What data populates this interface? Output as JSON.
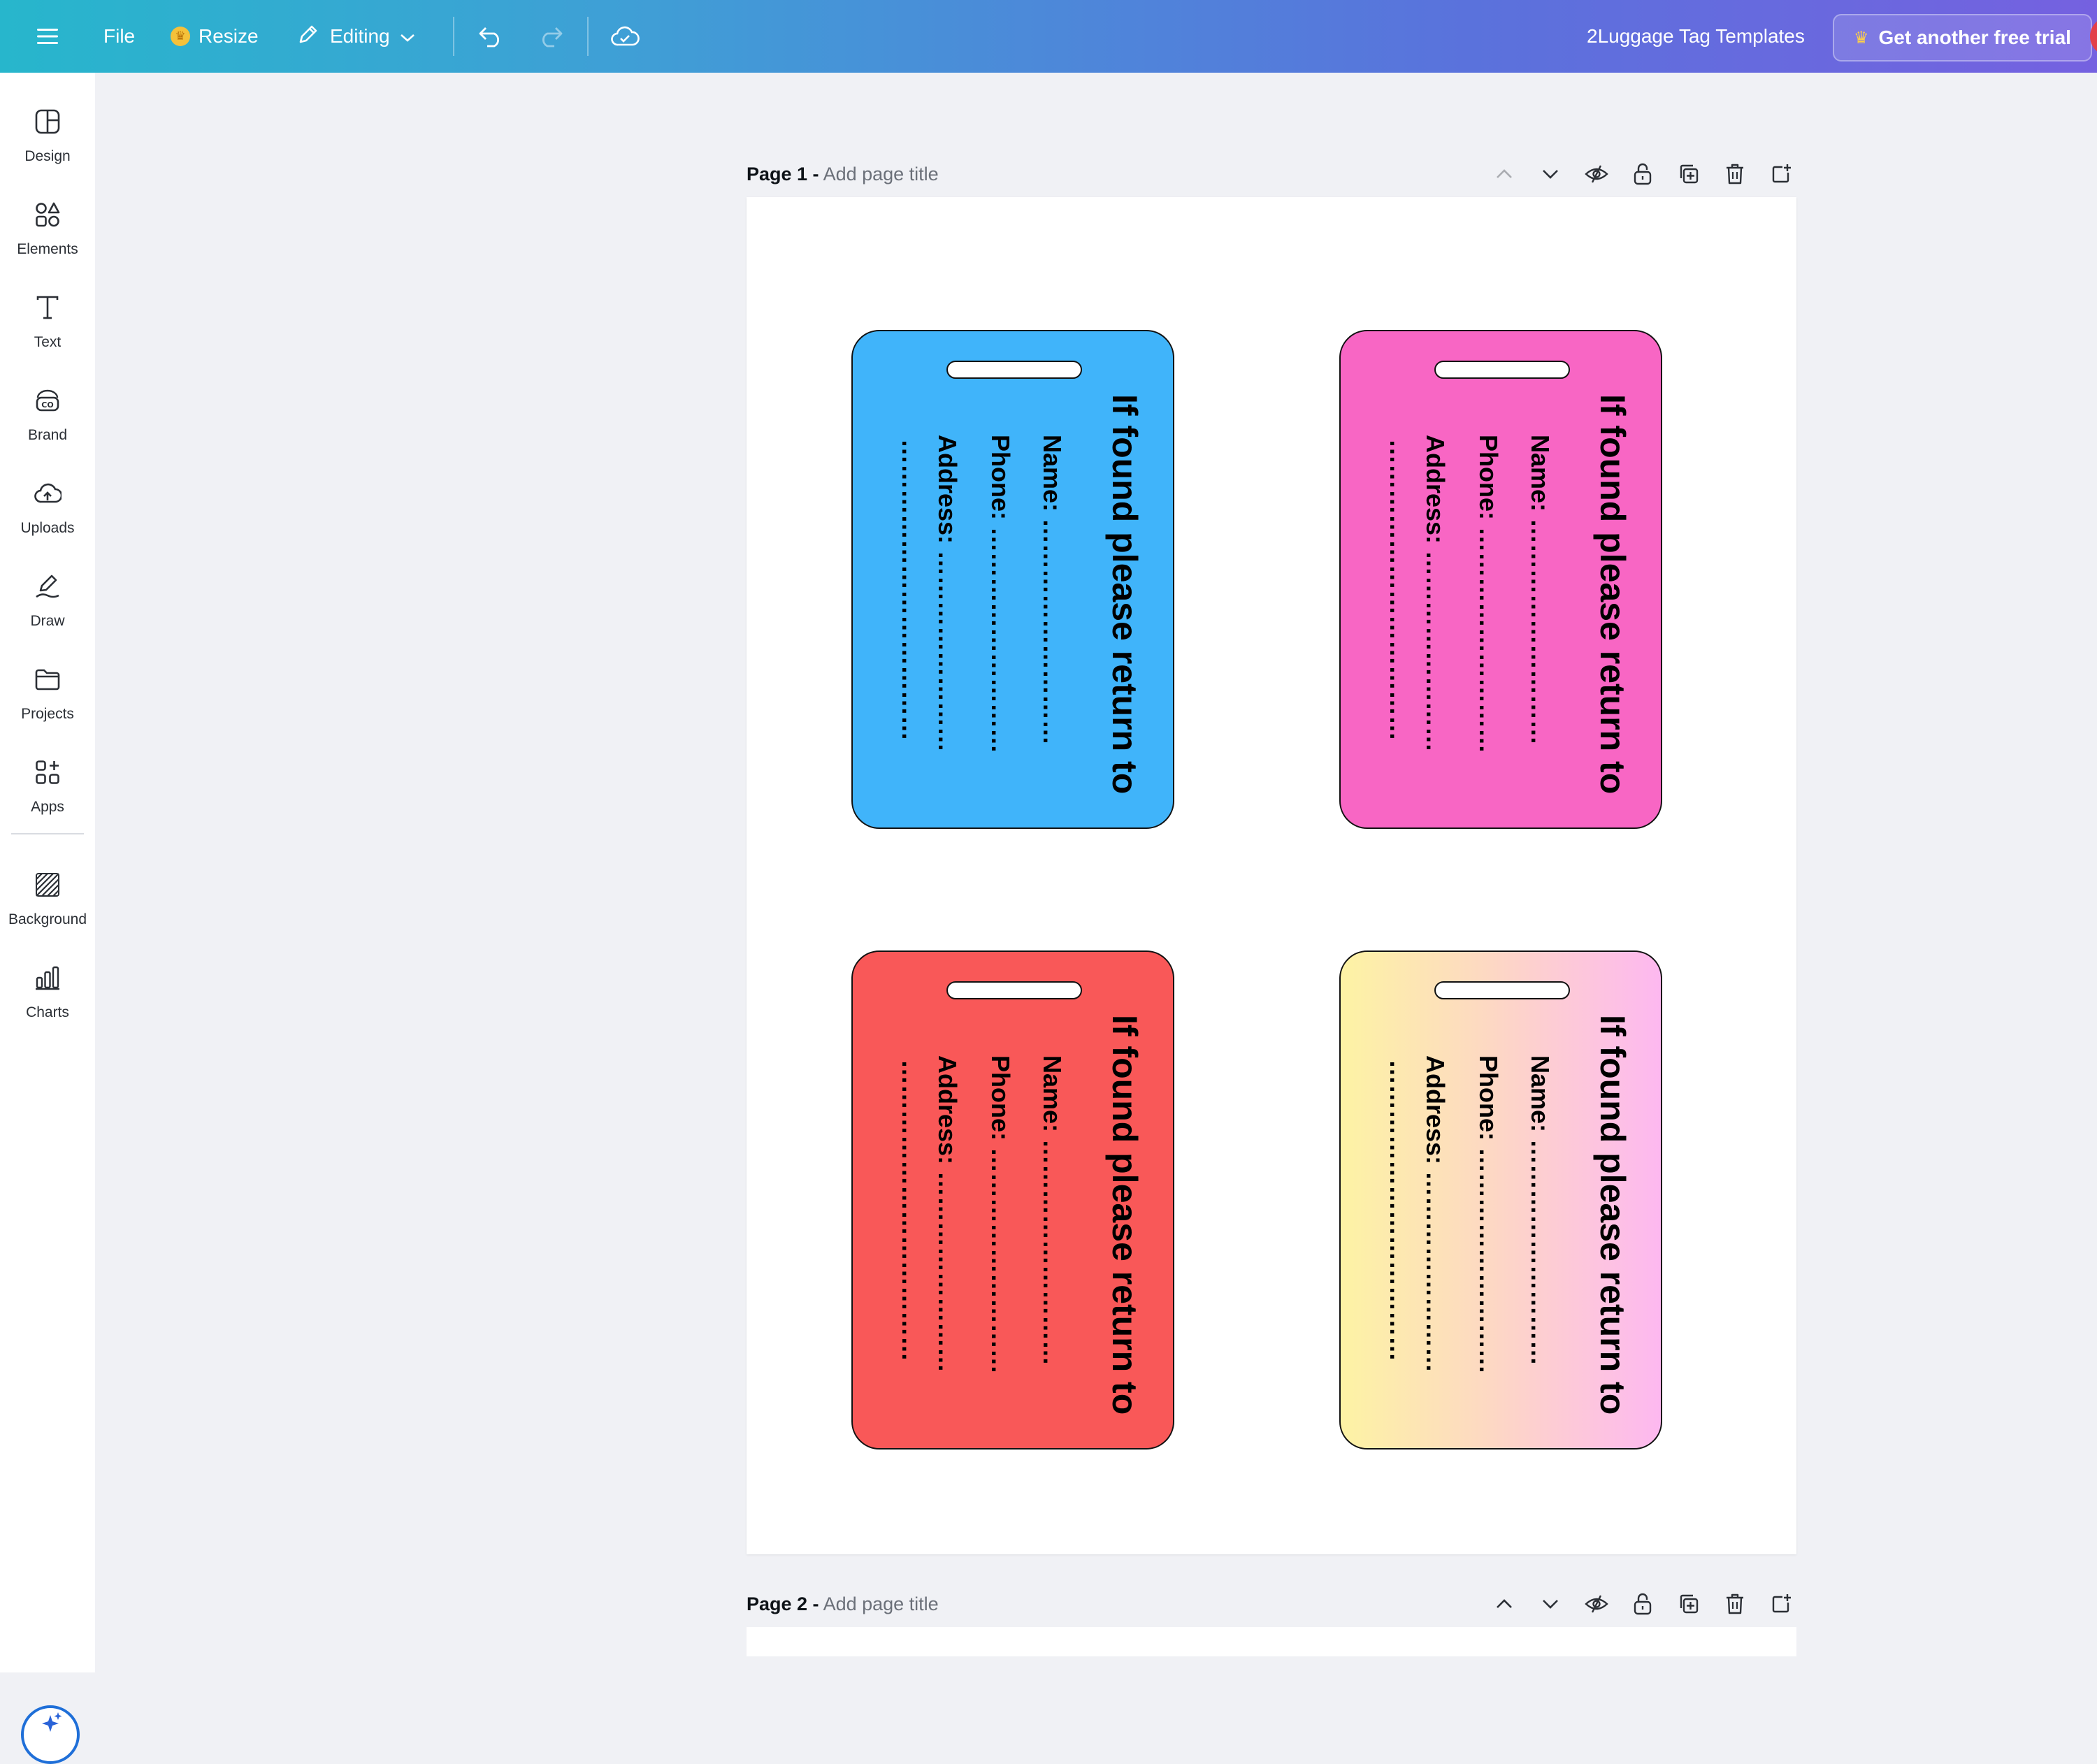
{
  "topbar": {
    "file_label": "File",
    "resize_label": "Resize",
    "editing_label": "Editing",
    "doc_title": "2Luggage Tag Templates",
    "trial_label": "Get another free trial"
  },
  "sidebar": {
    "items": [
      {
        "label": "Design"
      },
      {
        "label": "Elements"
      },
      {
        "label": "Text"
      },
      {
        "label": "Brand"
      },
      {
        "label": "Uploads"
      },
      {
        "label": "Draw"
      },
      {
        "label": "Projects"
      },
      {
        "label": "Apps"
      },
      {
        "label": "Background"
      },
      {
        "label": "Charts"
      }
    ]
  },
  "pages": [
    {
      "label": "Page 1 -",
      "title_placeholder": "Add page title"
    },
    {
      "label": "Page 2 -",
      "title_placeholder": "Add page title"
    }
  ],
  "tag": {
    "title": "If found please return to",
    "name_line": "Name: ………………………",
    "phone_line": "Phone: ………………………",
    "address_line": "Address: ……………………",
    "blank_line": "………………………………"
  },
  "colors": {
    "accent_from": "#27b6cc",
    "accent_to": "#7561e0",
    "tag_blue": "#40b4fa",
    "tag_pink": "#f866c4",
    "tag_red": "#f95858",
    "tag_gradient_from": "#fdf3a4",
    "tag_gradient_to": "#fdb8f0"
  }
}
